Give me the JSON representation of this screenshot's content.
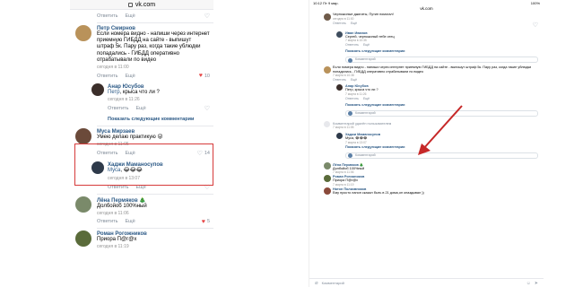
{
  "phone": {
    "url": "vk.com",
    "top_actions": {
      "reply": "Ответить",
      "share": "Ещё",
      "likes": ""
    },
    "comments": [
      {
        "name": "Петр Смирнов",
        "text": "Если номера видно - напиши через интернет приемную ГИБДД на сайте - выпишут штраф 5к. Пару раз, когда такие ублюдки попадались - ГИБДД оперативно отрабатывали по видео",
        "time": "сегодня в 11:00",
        "reply": "Ответить",
        "share": "Ещё",
        "likes": "10",
        "liked": true,
        "avatar_color": "#b9925a"
      },
      {
        "name": "Анар Юсубов",
        "mention": "Петр",
        "text": ", крыса что ли ?",
        "time": "сегодня в 11:26",
        "reply": "Ответить",
        "share": "Ещё",
        "likes": "",
        "avatar_color": "#3b2e2a",
        "is_reply": true
      },
      {
        "name": "Муса Мирзаев",
        "text": "Умею делаю практикую 😜",
        "time": "сегодня в 11:05",
        "reply": "Ответить",
        "share": "Ещё",
        "likes": "14",
        "avatar_color": "#6b4a3a"
      },
      {
        "name": "Хаджи Маманосупов",
        "mention": "Муса",
        "text": ", 😂😂😂",
        "time": "сегодня в 13:07",
        "reply": "Ответить",
        "share": "Ещё",
        "likes": "",
        "avatar_color": "#2e3a4a",
        "is_reply": true
      },
      {
        "name": "Лёна Пермяков 🎄",
        "text": "Долбойоб 100%ный",
        "time": "сегодня в 11:06",
        "reply": "Ответить",
        "share": "Ещё",
        "likes": "5",
        "liked": true,
        "avatar_color": "#7a8a6a"
      },
      {
        "name": "Роман Рогожников",
        "text": "Приора П@г@х",
        "time": "сегодня в 11:19",
        "reply": "",
        "share": "",
        "likes": "",
        "avatar_color": "#5a6b3a"
      }
    ],
    "show_more_label": "Показать следующие комментарии"
  },
  "tablet": {
    "status_time": "10:12",
    "status_date": "Пт 9 мар.",
    "status_right": "100%",
    "url": "vk.com",
    "comments": [
      {
        "name": "",
        "text": "Черножопые джигиты, Путин помогал!",
        "time": "сегодня в 11:00",
        "avatar_color": "#6f5b4a"
      },
      {
        "name": "Иван Иванов",
        "text": "Сергей, черножопый тебе отец",
        "time": "7 марта в 10:35",
        "avatar_color": "#3e4d5e",
        "reply": true
      },
      {
        "name": "",
        "text": "Если номера видно - напиши через интернет приемную ГИБДД на сайте - выпишут штраф 5к. Пару раз, когда такие ублюдки попадались - ГИБДД оперативно отрабатывали по видео",
        "time": "7 марта в 10:38",
        "avatar_color": "#b9925a"
      },
      {
        "name": "Анар Юсубов",
        "text": "Петр, крыса что ли ?",
        "time": "7 марта в 11:26",
        "avatar_color": "#3b2e2a",
        "reply": true
      },
      {
        "name": "Хаджи Маманосупов",
        "text": "Муса, 😂😂😂",
        "time": "7 марта в 13:07",
        "avatar_color": "#2e3a4a",
        "reply": true
      },
      {
        "name": "Лёна Пермяков 🎄",
        "text": "Долбойоб 100%ный",
        "time": "7 марта в 11:06",
        "avatar_color": "#7a8a6a"
      },
      {
        "name": "Роман Рогожников",
        "text": "Приора П@г@х",
        "time": "7 марта в 11:19",
        "avatar_color": "#5a6b3a"
      },
      {
        "name": "Натон Полковников",
        "text": "Ему просто ланон сказал быть в 21 дома,он опаздывал ))",
        "time": "",
        "avatar_color": "#8a4a3a"
      }
    ],
    "deleted_label": "Комментарий удалён пользователем",
    "deleted_time": "7 марта в 11:05",
    "show_more_label": "Показать следующие комментарии",
    "reply_label": "Ответить",
    "share_label": "Ещё",
    "input_placeholder": "Комментарий",
    "bottom_placeholder": "Комментарий"
  },
  "colors": {
    "link": "#2a5885",
    "highlight": "#d63b3b",
    "arrow": "#c62828"
  }
}
